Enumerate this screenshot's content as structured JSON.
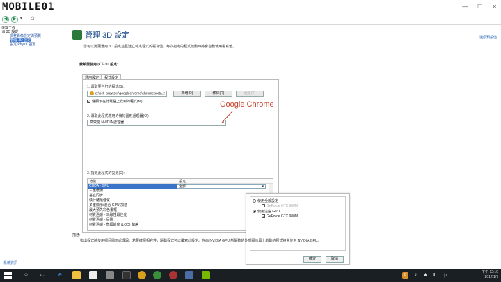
{
  "titlebar": {
    "logo_text": "MOBILE01"
  },
  "window_buttons": {
    "minimize": "—",
    "maximize": "☐",
    "close": "✕"
  },
  "nav": {
    "back": "◀",
    "forward": "▶",
    "dropdown": "▾",
    "home": "⌂"
  },
  "menubar": {
    "label": "選擇工作..."
  },
  "sidebar": {
    "root": "3D 設定",
    "items": [
      {
        "label": "調整影像設定與預覽"
      },
      {
        "label": "管理 3D 設定"
      },
      {
        "label": "設定 PhysX 設定"
      }
    ],
    "system_info": "系統資訊"
  },
  "main": {
    "title": "管理 3D 設定",
    "restore_link": "還原預設值",
    "description": "您可以變更通用 3D 設定並且建立特定程式的覆寫值。每次指定的程式啟動時將會自動使用覆寫值。",
    "heading": "我希望使用以下 3D 設定:",
    "tabs": [
      "通用設定",
      "程式設定"
    ],
    "step1": "1. 選取要自訂的程式(S):",
    "program_path": "d:\\net_browser\\googlechrome\\chromeporta...",
    "btn_add": "新增(D)",
    "btn_remove": "移除(R)",
    "btn_restore": "還原(T)",
    "chk_show_only": "僅顯示在此電腦上找到的程式(M)",
    "step2": "2. 選取此程式適用的偏好圖形處理器(O):",
    "processor": "高效能 NVIDIA 處理器",
    "step3": "3. 指定此程式的設定(C):",
    "table_headers": [
      "功能",
      "設定"
    ],
    "table_rows": [
      {
        "feature": "CUDA - GPU",
        "value": "全部"
      },
      {
        "feature": "三重緩衝",
        "value": ""
      },
      {
        "feature": "垂直同步",
        "value": ""
      },
      {
        "feature": "執行緒最佳化",
        "value": ""
      },
      {
        "feature": "多重顯示/混合 GPU 加速",
        "value": ""
      },
      {
        "feature": "最大預先彩色畫框",
        "value": ""
      },
      {
        "feature": "材質過濾 - 三線性最佳化",
        "value": ""
      },
      {
        "feature": "材質過濾 - 品質",
        "value": ""
      },
      {
        "feature": "材質過濾 - 負細節度 (LOD) 偏差",
        "value": ""
      }
    ],
    "desc_label": "描述:",
    "desc_text": "指出程式將使用哪個圖形處理器。若要確保相容性，驅動程式可以覆寫此設定。在由 NVIDIA GPU 所驅動的外部顯示器上啟動的程式將會使用 NVIDIA GPU。"
  },
  "callout": {
    "text": "Google Chrome",
    "color": "#c6402a"
  },
  "popup": {
    "opt_all": "使用全部設定",
    "opt_all_gpu": "GeForce GTX 980M",
    "opt_specific": "使用這些 GPU",
    "opt_specific_gpu": "GeForce GTX 980M",
    "ok": "確定",
    "cancel": "取消"
  },
  "taskbar": {
    "time": "下午 12:19",
    "date": "2017/1/7",
    "lang": "中",
    "badge": "8"
  },
  "colors": {
    "accent": "#3a74c9",
    "title": "#1a4a8a",
    "taskbar": "#1a1f24"
  }
}
